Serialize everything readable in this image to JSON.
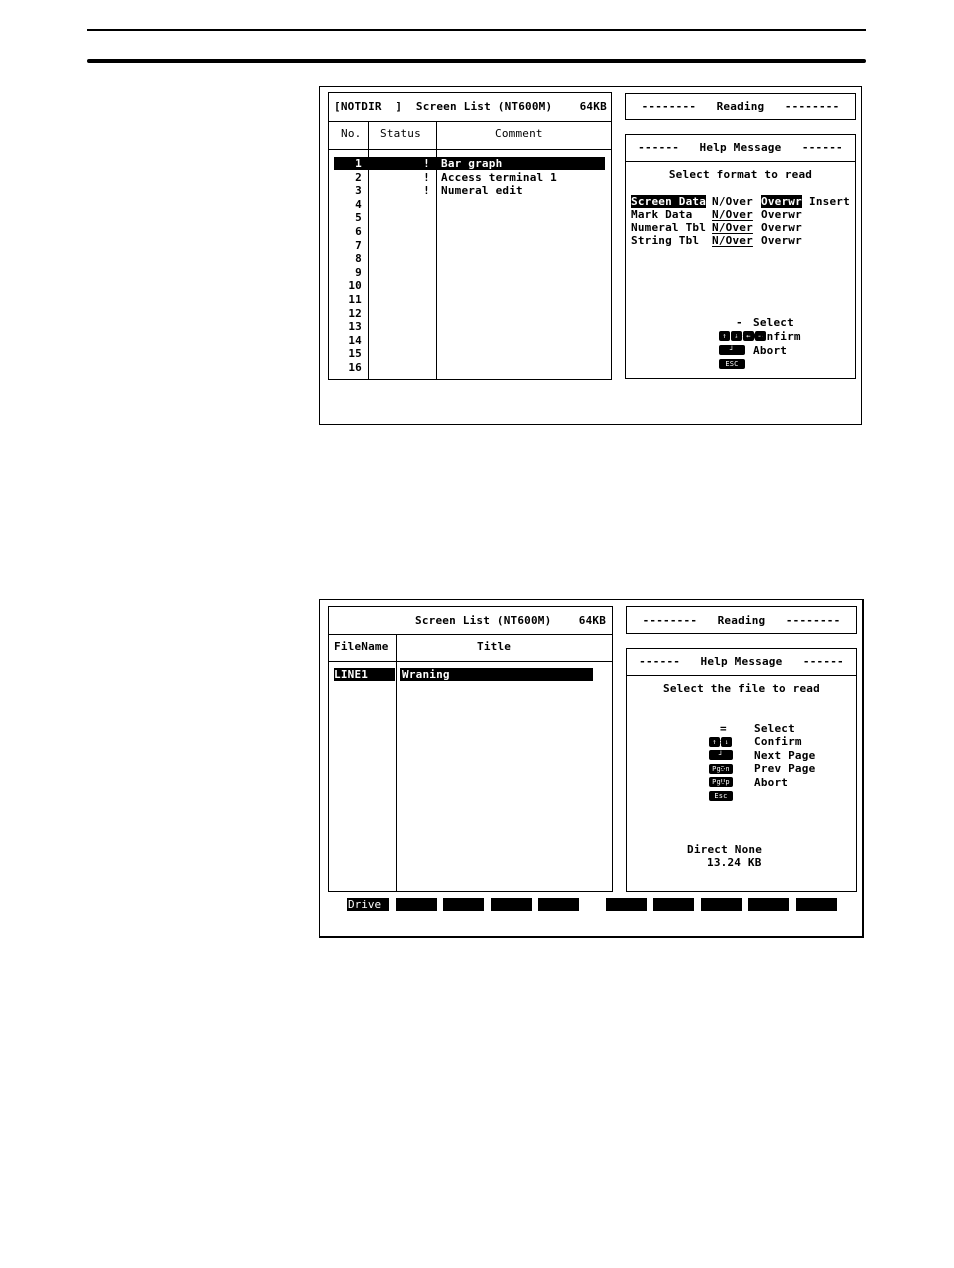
{
  "screen1": {
    "list_panel": {
      "header": "[NOTDIR  ]  Screen List (NT600M)    64KB",
      "columns": [
        "No.",
        "Status",
        "Comment"
      ],
      "rows": [
        {
          "no": "1",
          "status": "!",
          "comment": "Bar graph",
          "selected": true
        },
        {
          "no": "2",
          "status": "!",
          "comment": "Access terminal 1"
        },
        {
          "no": "3",
          "status": "!",
          "comment": "Numeral edit"
        },
        {
          "no": "4",
          "status": "",
          "comment": ""
        },
        {
          "no": "5",
          "status": "",
          "comment": ""
        },
        {
          "no": "6",
          "status": "",
          "comment": ""
        },
        {
          "no": "7",
          "status": "",
          "comment": ""
        },
        {
          "no": "8",
          "status": "",
          "comment": ""
        },
        {
          "no": "9",
          "status": "",
          "comment": ""
        },
        {
          "no": "10",
          "status": "",
          "comment": ""
        },
        {
          "no": "11",
          "status": "",
          "comment": ""
        },
        {
          "no": "12",
          "status": "",
          "comment": ""
        },
        {
          "no": "13",
          "status": "",
          "comment": ""
        },
        {
          "no": "14",
          "status": "",
          "comment": ""
        },
        {
          "no": "15",
          "status": "",
          "comment": ""
        },
        {
          "no": "16",
          "status": "",
          "comment": ""
        }
      ]
    },
    "mode_banner": "--------   Reading   --------",
    "help": {
      "title": "------   Help Message   ------",
      "prompt": "Select format to read",
      "formats": [
        {
          "label": "Screen Data",
          "options": [
            "N/Over",
            "Overwr",
            "Insert"
          ]
        },
        {
          "label": "Mark Data",
          "options": [
            "N/Over",
            "Overwr"
          ]
        },
        {
          "label": "Numeral Tbl",
          "options": [
            "N/Over",
            "Overwr"
          ]
        },
        {
          "label": "String Tbl",
          "options": [
            "N/Over",
            "Overwr"
          ]
        }
      ],
      "keys": [
        {
          "icons": [
            "up-arrow",
            "down-arrow",
            "left-arrow",
            "right-arrow"
          ],
          "sep": "-",
          "action": "Select"
        },
        {
          "icons": [
            "enter"
          ],
          "sep": "=",
          "action": "Confirm"
        },
        {
          "icons": [
            "ESC"
          ],
          "sep": "-",
          "action": "Abort"
        }
      ],
      "key_glyphs": {
        "up": "↑",
        "down": "↓",
        "left": "←",
        "right": "→",
        "enter": "┘",
        "esc": "ESC"
      }
    }
  },
  "screen2": {
    "list_panel": {
      "header": "Screen List (NT600M)    64KB",
      "columns": [
        "FileName",
        "Title"
      ],
      "rows": [
        {
          "filename": "LINE1",
          "title": "Wraning",
          "selected": true
        }
      ]
    },
    "mode_banner": "--------   Reading   --------",
    "help": {
      "title": "------   Help Message   ------",
      "prompt": "Select the file to read",
      "keys": [
        {
          "icon": "up-down",
          "sep": "=",
          "action": "Select"
        },
        {
          "icon": "enter",
          "sep": "=",
          "action": "Confirm"
        },
        {
          "icon": "PgDn",
          "sep": "-",
          "action": "Next Page"
        },
        {
          "icon": "PgUp",
          "sep": "=",
          "action": "Prev Page"
        },
        {
          "icon": "Esc",
          "sep": "-",
          "action": "Abort"
        }
      ],
      "key_glyphs": {
        "up": "↑",
        "down": "↓",
        "enter": "┘",
        "pgdn": "PgDn",
        "pgup": "PgUp",
        "esc": "Esc"
      },
      "directory": "Direct None",
      "size": "13.24 KB"
    },
    "function_keys": [
      "Drive",
      "",
      "",
      "",
      "",
      "",
      "",
      "",
      "",
      ""
    ]
  }
}
